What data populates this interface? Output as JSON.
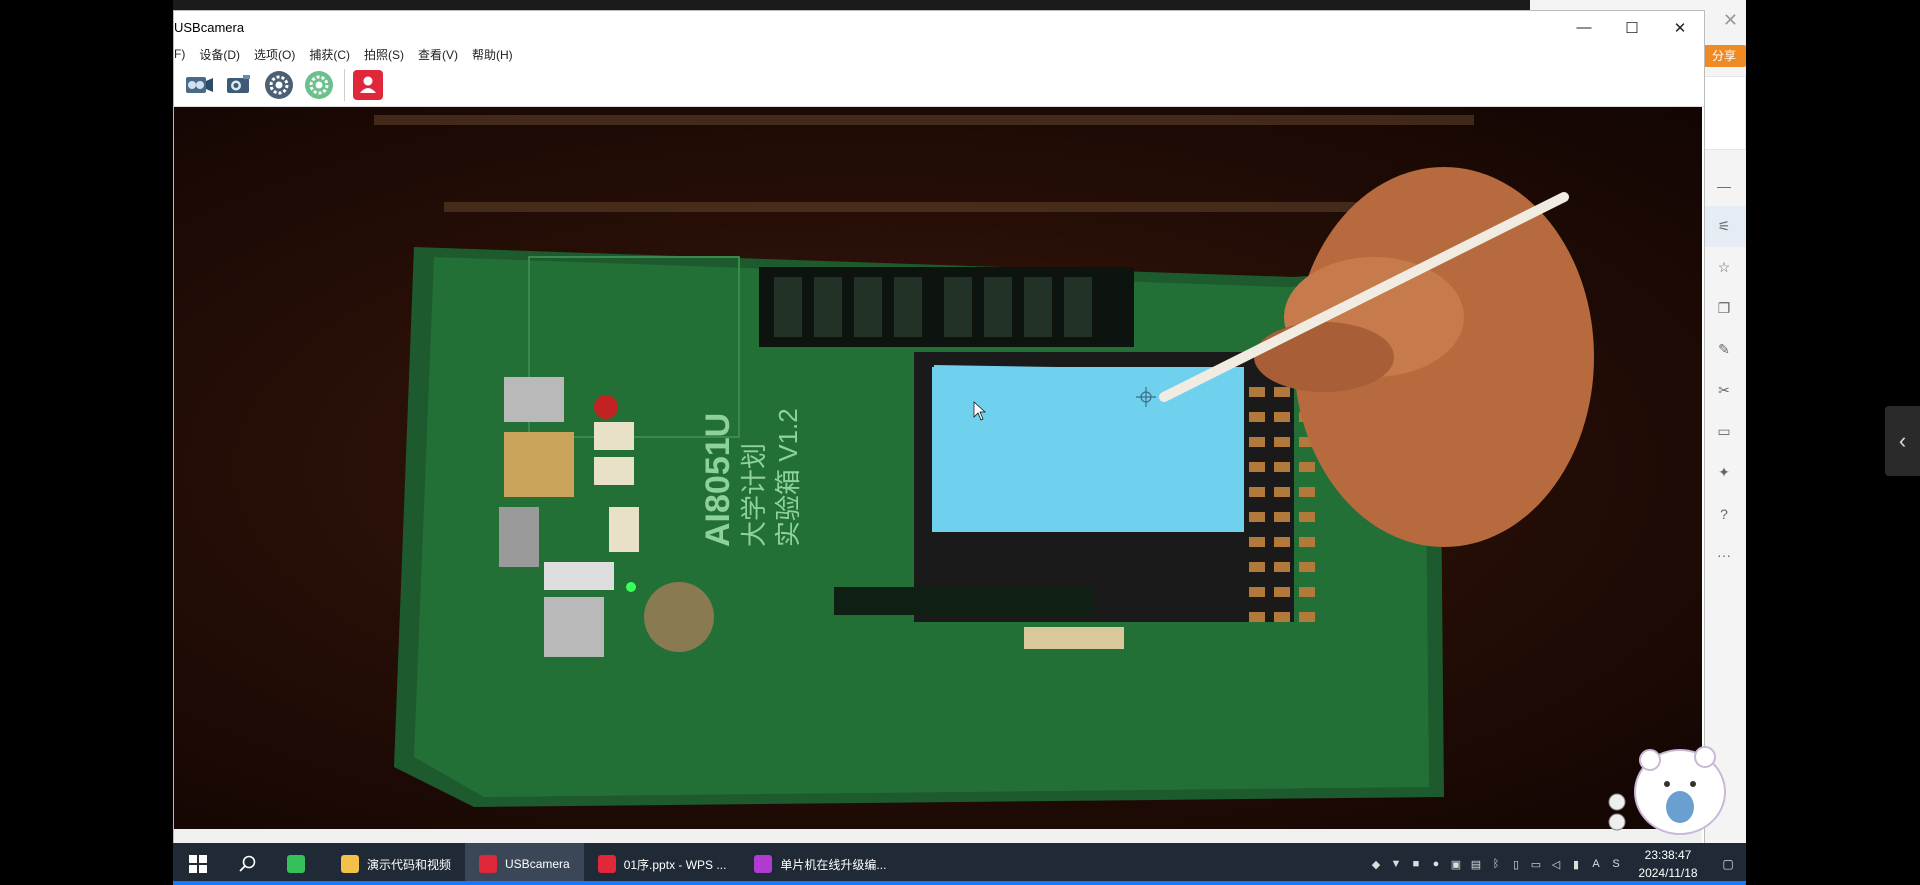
{
  "window": {
    "title": "USBcamera",
    "menu": [
      "F)",
      "设备(D)",
      "选项(O)",
      "捕获(C)",
      "拍照(S)",
      "查看(V)",
      "帮助(H)"
    ]
  },
  "side_panel": {
    "share_label": "分享",
    "icons": [
      "minus-icon",
      "sliders-icon",
      "star-icon",
      "copy-icon",
      "paint-icon",
      "tools-icon",
      "book-icon",
      "puzzle-icon",
      "help-icon",
      "more-icon"
    ]
  },
  "taskbar": {
    "apps": [
      {
        "label": "",
        "icon": "wechat-app-icon",
        "color": "#35c15a"
      },
      {
        "label": "演示代码和视频",
        "icon": "folder-icon",
        "color": "#f3c04a"
      },
      {
        "label": "USBcamera",
        "icon": "usbcamera-app-icon",
        "color": "#e0283b",
        "active": true
      },
      {
        "label": "01序.pptx - WPS ...",
        "icon": "wps-icon",
        "color": "#e0283b"
      },
      {
        "label": "单片机在线升级编...",
        "icon": "stc-app-icon",
        "color": "#b13bd0"
      }
    ],
    "time": "23:38:47",
    "date": "2024/11/18",
    "ime": "A"
  },
  "board_text": {
    "model": "AI8051U",
    "line2": "大学计划",
    "line3": "实验箱 V1.2"
  }
}
